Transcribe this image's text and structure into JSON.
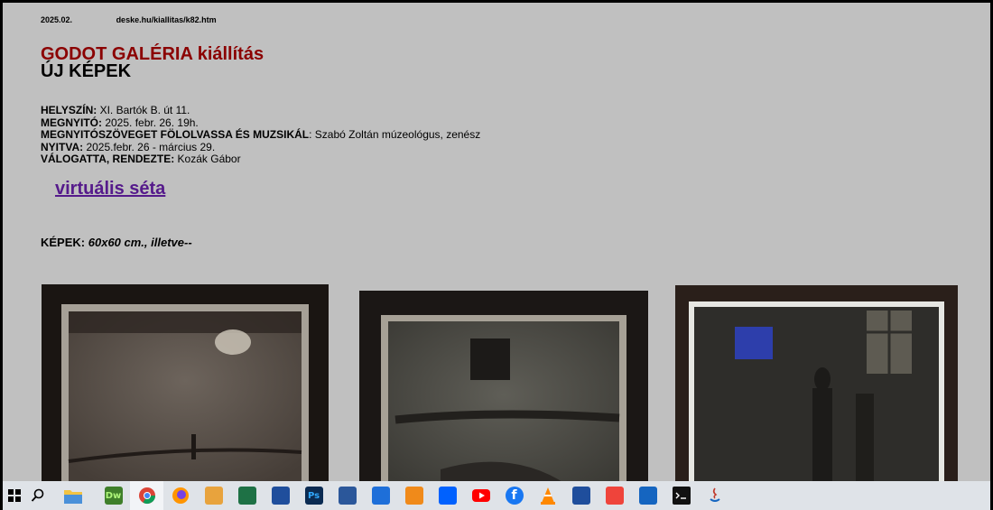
{
  "header": {
    "date": "2025.02.",
    "url": "deske.hu/kiallitas/k82.htm"
  },
  "title": {
    "line1": "GODOT GALÉRIA kiállítás",
    "line2": "ÚJ KÉPEK"
  },
  "info": [
    {
      "label": "HELYSZÍN:",
      "value": " XI. Bartók B. út 11."
    },
    {
      "label": "MEGNYITÓ:",
      "value": "  2025. febr. 26. 19h."
    },
    {
      "label": "MEGNYITÓSZÖVEGET FÖLOLVASSA ÉS MUZSIKÁL",
      "value": ": Szabó Zoltán múzeológus, zenész"
    },
    {
      "label": "NYITVA:",
      "value": "  2025.febr. 26 - március 29."
    },
    {
      "label": "VÁLOGATTA, RENDEZTE:",
      "value": " Kozák Gábor"
    }
  ],
  "link": {
    "label": "virtuális séta"
  },
  "kepek": {
    "label": "KÉPEK:",
    "value": "60x60 cm., illetve--"
  },
  "taskbar": {
    "icons": [
      {
        "name": "windows-start-icon",
        "glyph": "",
        "color": "#000000"
      },
      {
        "name": "search-icon",
        "glyph": "",
        "color": "#000000"
      },
      {
        "name": "file-explorer-icon",
        "glyph": "",
        "color": "#f3c342"
      },
      {
        "name": "dreamweaver-icon",
        "glyph": "Dw",
        "color": "#3f7f2a"
      },
      {
        "name": "chrome-icon",
        "glyph": "",
        "color": "#dd4b39"
      },
      {
        "name": "firefox-icon",
        "glyph": "",
        "color": "#e66000"
      },
      {
        "name": "outlook-icon",
        "glyph": "",
        "color": "#e8a33d"
      },
      {
        "name": "excel-icon",
        "glyph": "",
        "color": "#1e7145"
      },
      {
        "name": "floppy-save-icon",
        "glyph": "",
        "color": "#1f4e9c"
      },
      {
        "name": "photoshop-icon",
        "glyph": "Ps",
        "color": "#0b2b52"
      },
      {
        "name": "word-icon",
        "glyph": "",
        "color": "#2b579a"
      },
      {
        "name": "uploader-icon",
        "glyph": "",
        "color": "#1e6fd9"
      },
      {
        "name": "media-player-icon",
        "glyph": "",
        "color": "#f08a1a"
      },
      {
        "name": "dropbox-icon",
        "glyph": "",
        "color": "#0061fe"
      },
      {
        "name": "youtube-icon",
        "glyph": "",
        "color": "#ff0000"
      },
      {
        "name": "facebook-icon",
        "glyph": "f",
        "color": "#1877f2"
      },
      {
        "name": "vlc-icon",
        "glyph": "",
        "color": "#ff8800"
      },
      {
        "name": "floppy-disk-icon",
        "glyph": "",
        "color": "#1f4e9c"
      },
      {
        "name": "anydesk-icon",
        "glyph": "",
        "color": "#ef443b"
      },
      {
        "name": "remote-desktop-icon",
        "glyph": "",
        "color": "#1565c0"
      },
      {
        "name": "terminal-icon",
        "glyph": "",
        "color": "#111111"
      },
      {
        "name": "java-icon",
        "glyph": "",
        "color": "#c0392b"
      }
    ]
  }
}
